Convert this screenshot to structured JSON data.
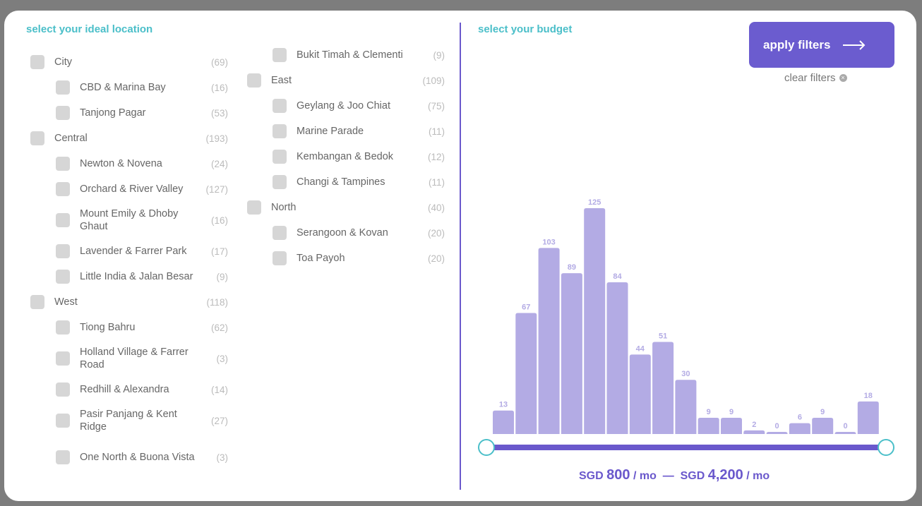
{
  "location": {
    "heading": "select your ideal location",
    "columns": [
      [
        {
          "type": "group",
          "label": "City",
          "count": "(69)"
        },
        {
          "type": "item",
          "label": "CBD & Marina Bay",
          "count": "(16)"
        },
        {
          "type": "item",
          "label": "Tanjong Pagar",
          "count": "(53)"
        },
        {
          "type": "group",
          "label": "Central",
          "count": "(193)"
        },
        {
          "type": "item",
          "label": "Newton & Novena",
          "count": "(24)"
        },
        {
          "type": "item",
          "label": "Orchard & River Valley",
          "count": "(127)"
        },
        {
          "type": "item",
          "label": "Mount Emily & Dhoby Ghaut",
          "count": "(16)",
          "two": true
        },
        {
          "type": "item",
          "label": "Lavender & Farrer Park",
          "count": "(17)"
        },
        {
          "type": "item",
          "label": "Little India & Jalan Besar",
          "count": "(9)"
        },
        {
          "type": "group",
          "label": "West",
          "count": "(118)"
        },
        {
          "type": "item",
          "label": "Tiong Bahru",
          "count": "(62)"
        },
        {
          "type": "item",
          "label": "Holland Village & Farrer Road",
          "count": "(3)",
          "two": true
        },
        {
          "type": "item",
          "label": "Redhill & Alexandra",
          "count": "(14)"
        },
        {
          "type": "item",
          "label": "Pasir Panjang & Kent Ridge",
          "count": "(27)",
          "two": true
        },
        {
          "type": "item",
          "label": "One North & Buona Vista",
          "count": "(3)",
          "two": true
        }
      ],
      [
        {
          "type": "item",
          "label": "Bukit Timah & Clementi",
          "count": "(9)"
        },
        {
          "type": "group",
          "label": "East",
          "count": "(109)"
        },
        {
          "type": "item",
          "label": "Geylang & Joo Chiat",
          "count": "(75)"
        },
        {
          "type": "item",
          "label": "Marine Parade",
          "count": "(11)"
        },
        {
          "type": "item",
          "label": "Kembangan & Bedok",
          "count": "(12)"
        },
        {
          "type": "item",
          "label": "Changi & Tampines",
          "count": "(11)"
        },
        {
          "type": "group",
          "label": "North",
          "count": "(40)"
        },
        {
          "type": "item",
          "label": "Serangoon & Kovan",
          "count": "(20)"
        },
        {
          "type": "item",
          "label": "Toa Payoh",
          "count": "(20)"
        }
      ]
    ]
  },
  "budget": {
    "heading": "select your budget",
    "apply_label": "apply filters",
    "clear_label": "clear filters",
    "currency": "SGD",
    "min": "800",
    "max": "4,200",
    "unit": "/ mo",
    "separator": "—",
    "range_fraction": [
      0,
      1
    ]
  },
  "chart_data": {
    "type": "bar",
    "values": [
      13,
      67,
      103,
      89,
      125,
      84,
      44,
      51,
      30,
      9,
      9,
      2,
      0,
      6,
      9,
      0,
      18
    ],
    "color": "#b3abe4"
  },
  "colors": {
    "accent": "#6a58cc",
    "teal": "#4bbfc9"
  }
}
